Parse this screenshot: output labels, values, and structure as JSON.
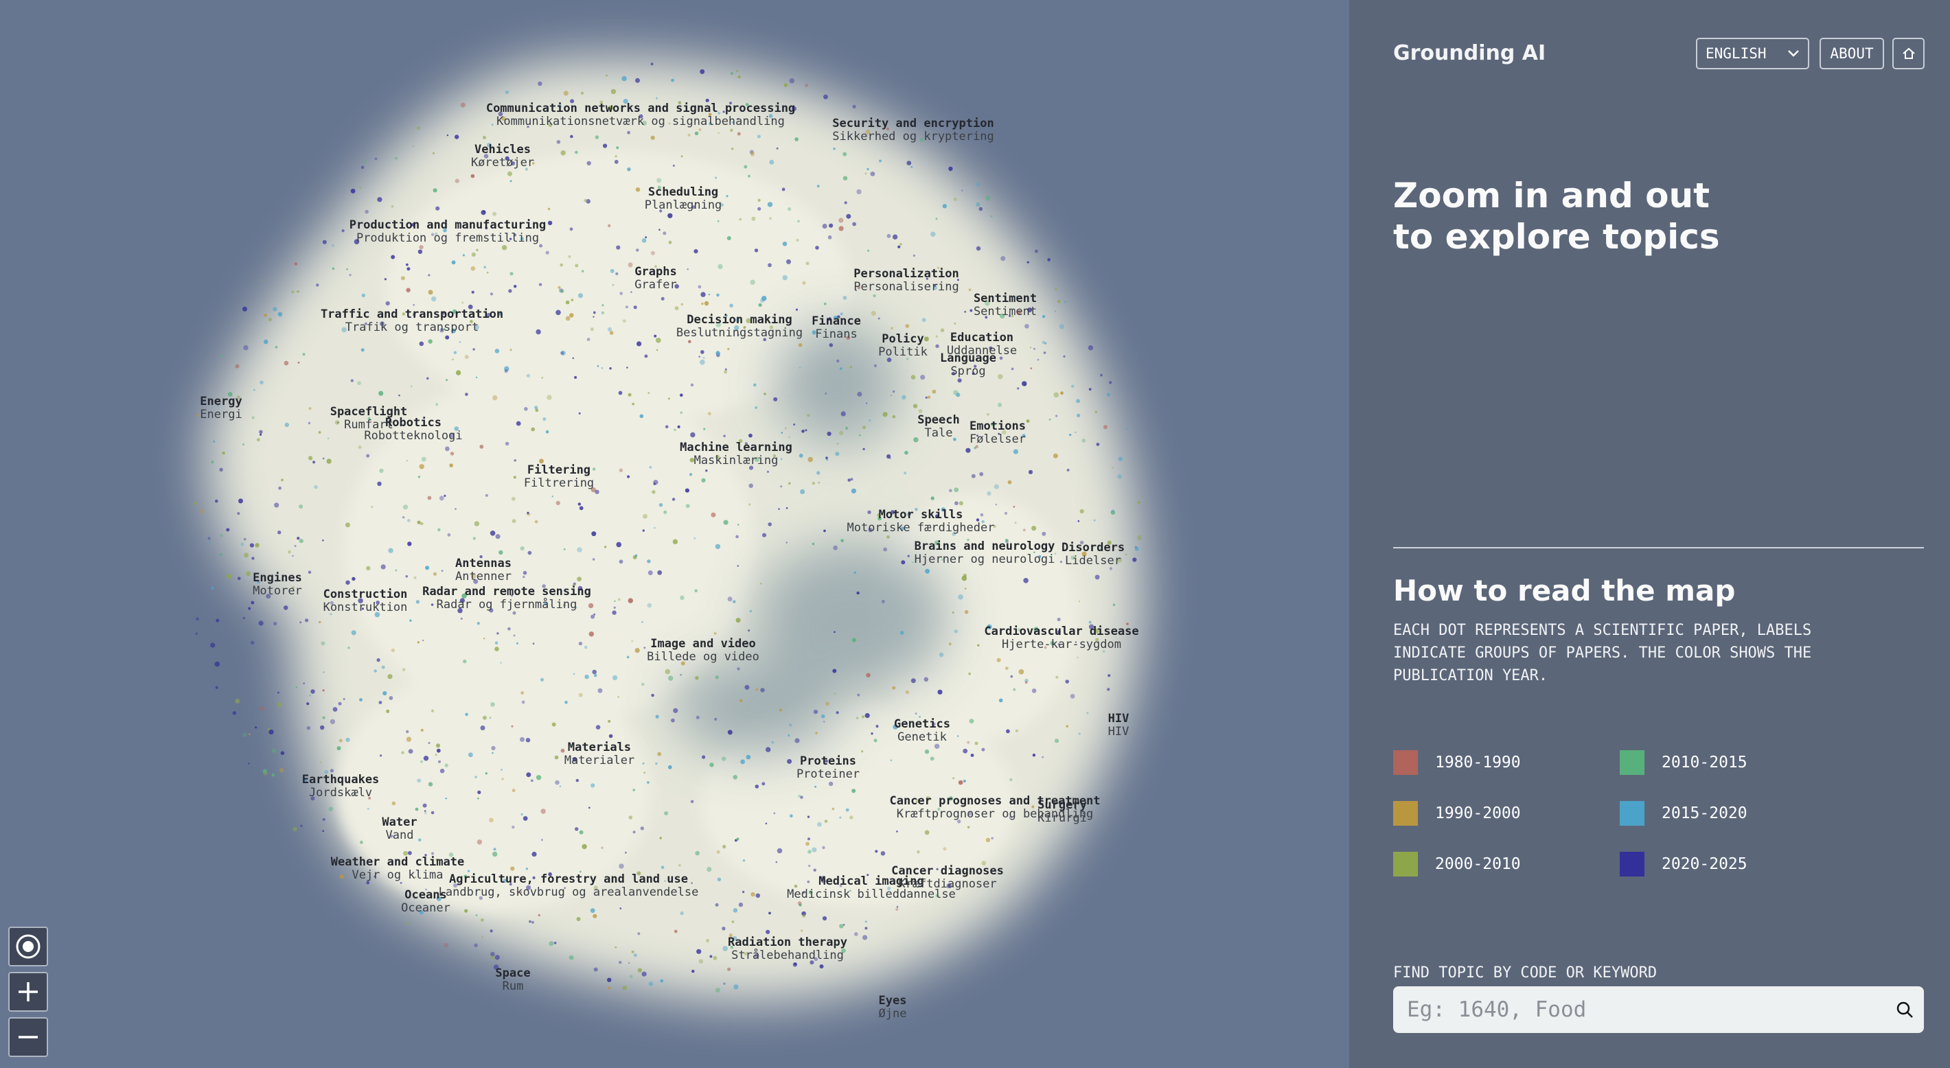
{
  "app": {
    "title": "Grounding AI"
  },
  "header": {
    "language": "ENGLISH",
    "about_label": "ABOUT",
    "home_icon": "home-icon"
  },
  "intro": {
    "line1": "Zoom in and out",
    "line2": "to explore topics"
  },
  "how_to": {
    "title": "How to read the map",
    "description": "Each dot represents a scientific paper, labels indicate groups of papers. The color shows the publication year."
  },
  "legend": [
    {
      "label": "1980-1990",
      "color": "#b0645c"
    },
    {
      "label": "1990-2000",
      "color": "#b9973f"
    },
    {
      "label": "2000-2010",
      "color": "#8ea64a"
    },
    {
      "label": "2010-2015",
      "color": "#58b07c"
    },
    {
      "label": "2015-2020",
      "color": "#4ca3c9"
    },
    {
      "label": "2020-2025",
      "color": "#34309a"
    }
  ],
  "search": {
    "label": "FIND TOPIC BY CODE OR KEYWORD",
    "placeholder": "Eg: 1640, Food",
    "icon": "search-icon"
  },
  "map_controls": {
    "recenter_icon": "target-icon",
    "zoom_in_icon": "plus-icon",
    "zoom_out_icon": "minus-icon"
  },
  "topics": [
    {
      "en": "Communication networks and signal processing",
      "da": "Kommunikationsnetværk og signalbehandling"
    },
    {
      "en": "Security and encryption",
      "da": "Sikkerhed og kryptering"
    },
    {
      "en": "Vehicles",
      "da": "Køretøjer"
    },
    {
      "en": "Scheduling",
      "da": "Planlægning"
    },
    {
      "en": "Production and manufacturing",
      "da": "Produktion og fremstilling"
    },
    {
      "en": "Graphs",
      "da": "Grafer"
    },
    {
      "en": "Personalization",
      "da": "Personalisering"
    },
    {
      "en": "Sentiment",
      "da": "Sentiment"
    },
    {
      "en": "Traffic and transportation",
      "da": "Trafik og transport"
    },
    {
      "en": "Decision making",
      "da": "Beslutningstagning"
    },
    {
      "en": "Finance",
      "da": "Finans"
    },
    {
      "en": "Policy",
      "da": "Politik"
    },
    {
      "en": "Education",
      "da": "Uddannelse"
    },
    {
      "en": "Language",
      "da": "Sprog"
    },
    {
      "en": "Energy",
      "da": "Energi"
    },
    {
      "en": "Spaceflight",
      "da": "Rumfart"
    },
    {
      "en": "Robotics",
      "da": "Robotteknologi"
    },
    {
      "en": "Speech",
      "da": "Tale"
    },
    {
      "en": "Emotions",
      "da": "Følelser"
    },
    {
      "en": "Machine learning",
      "da": "Maskinlæring"
    },
    {
      "en": "Filtering",
      "da": "Filtrering"
    },
    {
      "en": "Motor skills",
      "da": "Motoriske færdigheder"
    },
    {
      "en": "Brains and neurology",
      "da": "Hjerner og neurologi"
    },
    {
      "en": "Disorders",
      "da": "Lidelser"
    },
    {
      "en": "Antennas",
      "da": "Antenner"
    },
    {
      "en": "Engines",
      "da": "Motorer"
    },
    {
      "en": "Construction",
      "da": "Konstruktion"
    },
    {
      "en": "Radar and remote sensing",
      "da": "Radar og fjernmåling"
    },
    {
      "en": "Cardiovascular disease",
      "da": "Hjerte-kar-sygdom"
    },
    {
      "en": "Image and video",
      "da": "Billede og video"
    },
    {
      "en": "Genetics",
      "da": "Genetik"
    },
    {
      "en": "HIV",
      "da": "HIV"
    },
    {
      "en": "Materials",
      "da": "Materialer"
    },
    {
      "en": "Proteins",
      "da": "Proteiner"
    },
    {
      "en": "Earthquakes",
      "da": "Jordskælv"
    },
    {
      "en": "Cancer prognoses and treatment",
      "da": "Kræftprognoser og behandling"
    },
    {
      "en": "Surgery",
      "da": "Kirurgi"
    },
    {
      "en": "Water",
      "da": "Vand"
    },
    {
      "en": "Weather and climate",
      "da": "Vejr og klima"
    },
    {
      "en": "Agriculture, forestry and land use",
      "da": "Landbrug, skovbrug og arealanvendelse"
    },
    {
      "en": "Oceans",
      "da": "Oceaner"
    },
    {
      "en": "Medical imaging",
      "da": "Medicinsk billeddannelse"
    },
    {
      "en": "Cancer diagnoses",
      "da": "Kræftdiagnoser"
    },
    {
      "en": "Radiation therapy",
      "da": "Strålebehandling"
    },
    {
      "en": "Space",
      "da": "Rum"
    },
    {
      "en": "Eyes",
      "da": "Øjne"
    }
  ]
}
